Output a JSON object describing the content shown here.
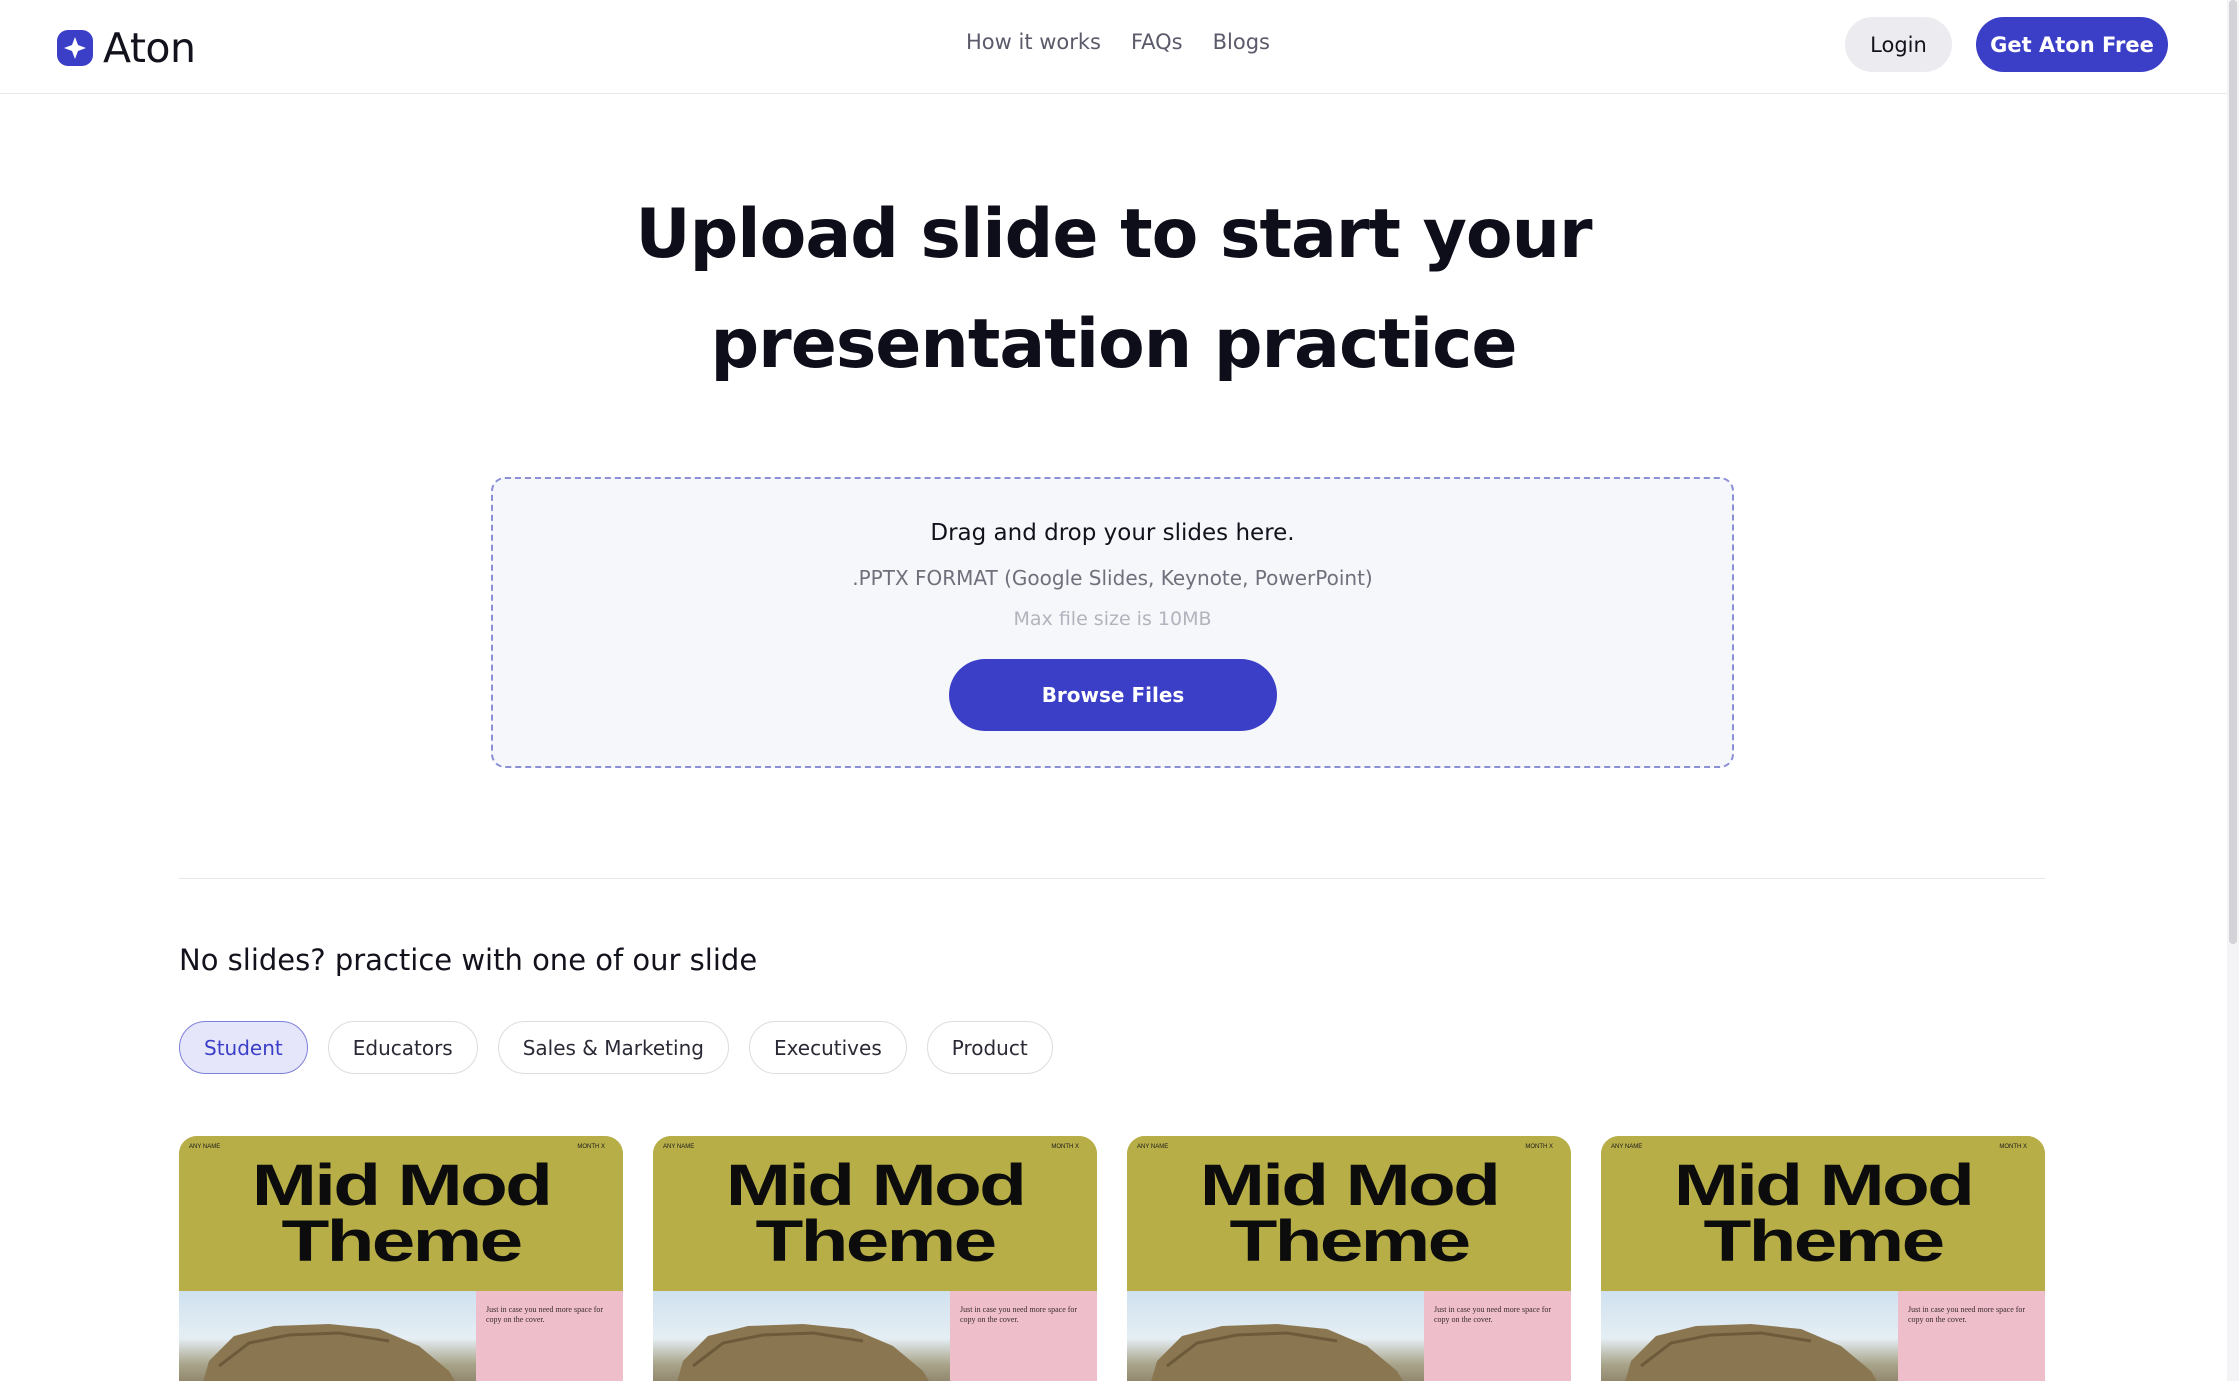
{
  "brand": {
    "name": "Aton",
    "accent": "#3b3ec6"
  },
  "nav": {
    "items": [
      "How it works",
      "FAQs",
      "Blogs"
    ]
  },
  "header": {
    "login_label": "Login",
    "cta_label": "Get Aton Free"
  },
  "hero": {
    "title_line1": "Upload slide to start your",
    "title_line2": "presentation practice"
  },
  "upload": {
    "title": "Drag and drop your slides here.",
    "format": ".PPTX FORMAT (Google Slides, Keynote, PowerPoint)",
    "max_size": "Max file size is 10MB",
    "button_label": "Browse Files"
  },
  "samples": {
    "title": "No slides? practice with one of our slide",
    "tabs": [
      {
        "label": "Student",
        "active": true
      },
      {
        "label": "Educators",
        "active": false
      },
      {
        "label": "Sales & Marketing",
        "active": false
      },
      {
        "label": "Executives",
        "active": false
      },
      {
        "label": "Product",
        "active": false
      }
    ],
    "cards": [
      {
        "line1": "Mid Mod",
        "line2": "Theme",
        "small_left": "ANY NAME",
        "small_right": "MONTH X",
        "side_text": "Just in case you need more space for copy on the cover."
      },
      {
        "line1": "Mid Mod",
        "line2": "Theme",
        "small_left": "ANY NAME",
        "small_right": "MONTH X",
        "side_text": "Just in case you need more space for copy on the cover."
      },
      {
        "line1": "Mid Mod",
        "line2": "Theme",
        "small_left": "ANY NAME",
        "small_right": "MONTH X",
        "side_text": "Just in case you need more space for copy on the cover."
      },
      {
        "line1": "Mid Mod",
        "line2": "Theme",
        "small_left": "ANY NAME",
        "small_right": "MONTH X",
        "side_text": "Just in case you need more space for copy on the cover."
      }
    ]
  }
}
